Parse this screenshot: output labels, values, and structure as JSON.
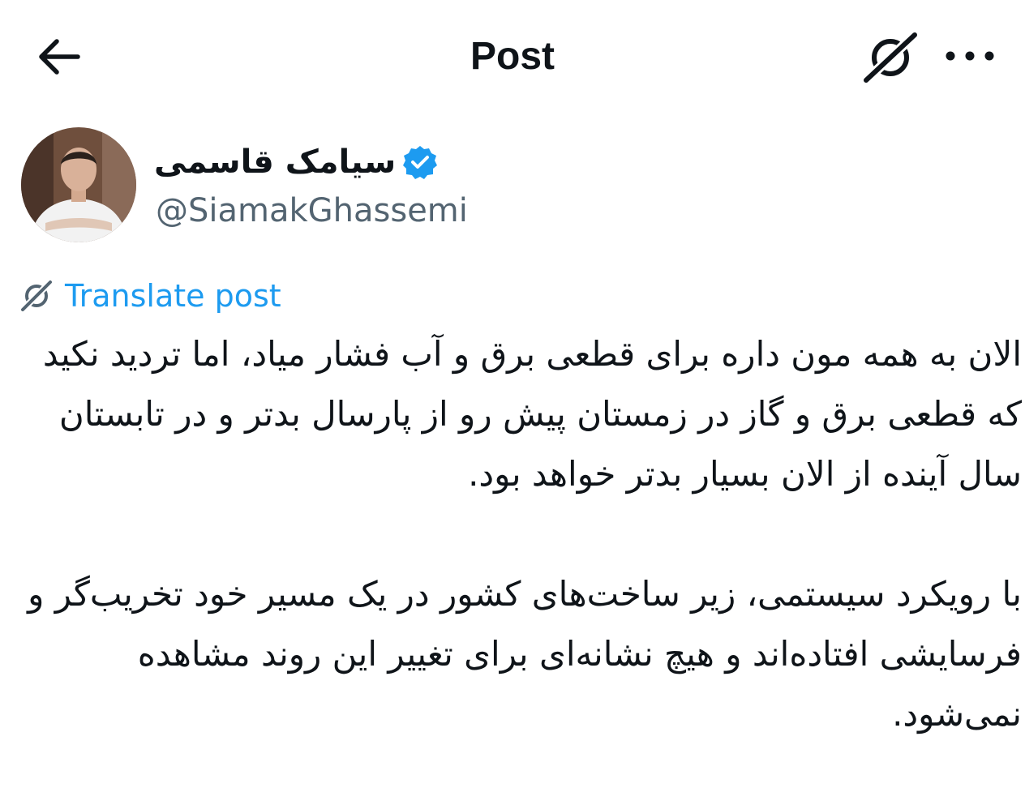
{
  "header": {
    "title": "Post",
    "back_icon": "arrow-left-icon",
    "grok_icon": "grok-icon",
    "more_icon": "more-horizontal-icon"
  },
  "author": {
    "name": "سیامک قاسمی",
    "handle": "@SiamakGhassemi",
    "verified": true,
    "verified_color": "#1d9bf0"
  },
  "translate": {
    "label": "Translate post",
    "icon": "grok-icon",
    "color": "#1d9bf0"
  },
  "post": {
    "paragraphs": [
      "الان به همه مون داره برای قطعی برق و آب فشار میاد، اما تردید نکید که قطعی برق و گاز در زمستان پیش رو از پارسال بدتر و در تابستان سال آینده از الان بسیار بدتر خواهد بود.",
      "با رویکرد سیستمی، زیر ساخت‌های کشور در یک مسیر خود تخریب‌گر و فرسایشی افتاده‌اند و هیچ نشانه‌ای برای تغییر این روند مشاهده نمی‌شود."
    ]
  }
}
